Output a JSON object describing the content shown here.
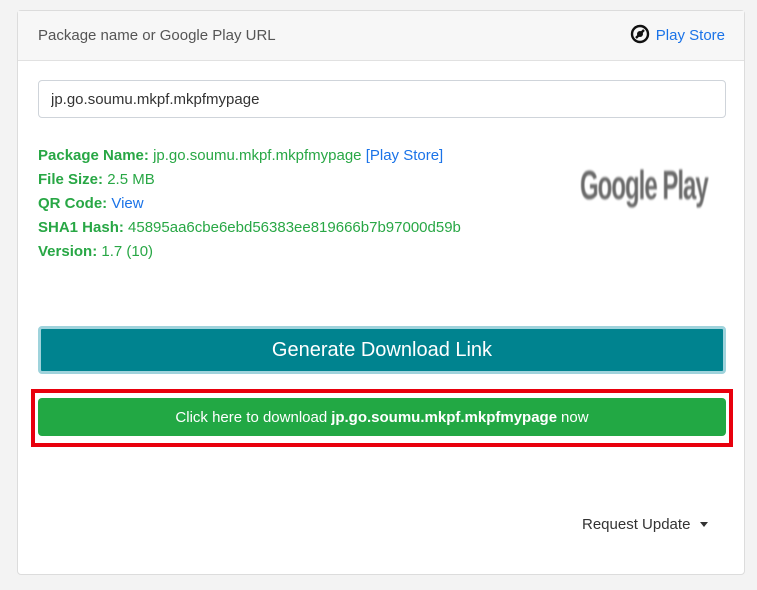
{
  "header": {
    "title": "Package name or Google Play URL",
    "link_label": "Play Store",
    "link_icon": "play-store-icon"
  },
  "search": {
    "value": "jp.go.soumu.mkpf.mkpfmypage"
  },
  "info": {
    "package_name_label": "Package Name:",
    "package_name_value": "jp.go.soumu.mkpf.mkpfmypage",
    "package_name_link": "[Play Store]",
    "file_size_label": "File Size:",
    "file_size_value": "2.5 MB",
    "qr_code_label": "QR Code:",
    "qr_code_link": "View",
    "sha1_label": "SHA1 Hash:",
    "sha1_value": "45895aa6cbe6ebd56383ee819666b7b97000d59b",
    "version_label": "Version:",
    "version_value": "1.7 (10)"
  },
  "logo": {
    "text": "Google Play"
  },
  "buttons": {
    "generate_label": "Generate Download Link",
    "download_prefix": "Click here to download",
    "download_package": "jp.go.soumu.mkpf.mkpfmypage",
    "download_suffix": "now"
  },
  "footer": {
    "request_update_label": "Request Update"
  },
  "colors": {
    "accent_green": "#28a745",
    "link_blue": "#1a73e8",
    "generate_button": "#00838f",
    "download_button": "#22a844",
    "highlight_red": "#e8000d"
  }
}
